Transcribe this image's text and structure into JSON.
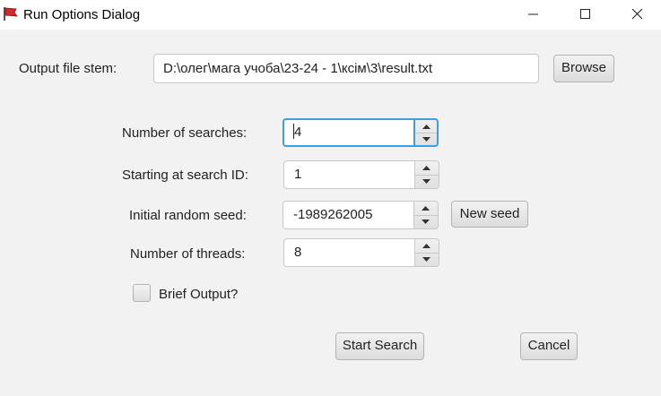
{
  "window": {
    "title": "Run Options Dialog",
    "icon": "app-flag-icon",
    "controls": [
      "minimize-icon",
      "maximize-icon",
      "close-icon"
    ]
  },
  "output": {
    "label": "Output file stem:",
    "value": "D:\\олег\\мага учоба\\23-24 - 1\\ксім\\3\\result.txt",
    "browse_label": "Browse"
  },
  "searches": {
    "label": "Number of searches:",
    "value": "4"
  },
  "start_id": {
    "label": "Starting at search ID:",
    "value": "1"
  },
  "seed": {
    "label": "Initial random seed:",
    "value": "-1989262005",
    "new_seed_label": "New seed"
  },
  "threads": {
    "label": "Number of threads:",
    "value": "8"
  },
  "brief": {
    "label": "Brief Output?",
    "checked": false
  },
  "actions": {
    "start_label": "Start Search",
    "cancel_label": "Cancel"
  },
  "colors": {
    "focus": "#3c9ee0",
    "background": "#f2f2f2"
  }
}
